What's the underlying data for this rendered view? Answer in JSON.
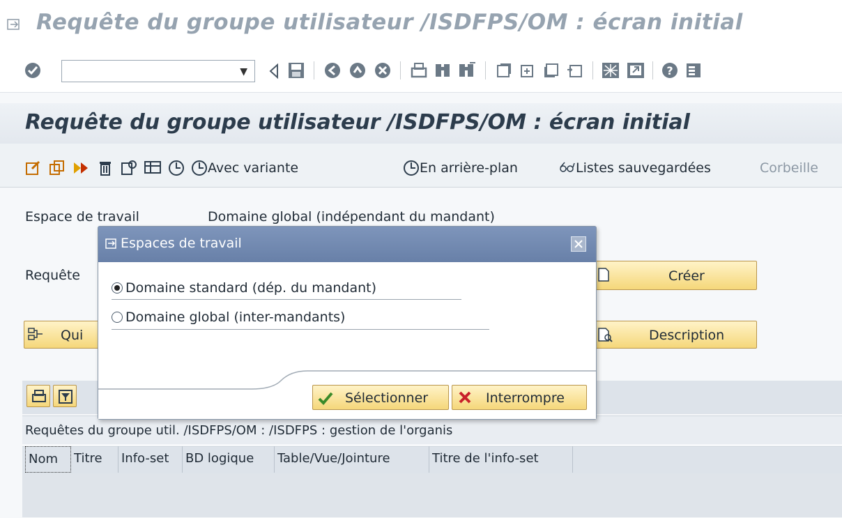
{
  "window": {
    "title": "Requête du groupe utilisateur /ISDFPS/OM : écran initial"
  },
  "system_toolbar": {
    "command_field_value": "",
    "icons": [
      "enter-icon",
      "back-icon",
      "save-icon",
      "back-green-icon",
      "exit-icon",
      "cancel-icon",
      "print-icon",
      "find-icon",
      "find-next-icon",
      "first-page-icon",
      "prev-page-icon",
      "next-page-icon",
      "last-page-icon",
      "new-session-icon",
      "shortcut-icon",
      "help-icon",
      "layout-menu-icon"
    ]
  },
  "screen": {
    "title": "Requête du groupe utilisateur /ISDFPS/OM : écran initial",
    "toolbar": {
      "avec_variante": "Avec variante",
      "en_arriere_plan": "En arrière-plan",
      "listes_sauvegardees": "Listes sauvegardées",
      "corbeille": "Corbeille"
    },
    "workspace_label": "Espace de travail",
    "workspace_value": "Domaine global (indépendant du mandant)",
    "requete_label": "Requête",
    "create_button": "Créer",
    "quick_button": "Qui",
    "description_button": "Description",
    "list_title": "Requêtes du groupe util. /ISDFPS/OM : /ISDFPS : gestion de l'organis",
    "columns": [
      "Nom",
      "Titre",
      "Info-set",
      "BD logique",
      "Table/Vue/Jointure",
      "Titre de l'info-set"
    ]
  },
  "dialog": {
    "title": "Espaces de travail",
    "options": [
      {
        "label": "Domaine standard (dép. du mandant)",
        "selected": true
      },
      {
        "label": "Domaine global (inter-mandants)",
        "selected": false
      }
    ],
    "select_button": "Sélectionner",
    "cancel_button": "Interrompre"
  }
}
